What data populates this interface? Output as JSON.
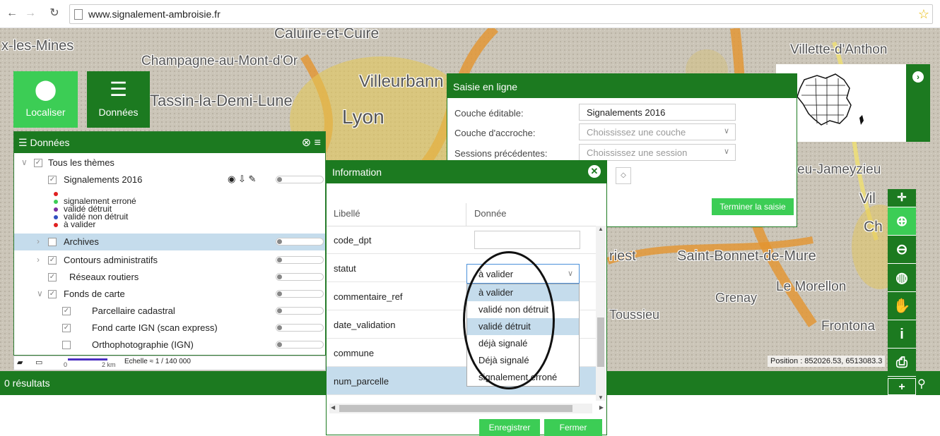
{
  "browser": {
    "url": "www.signalement-ambroisie.fr"
  },
  "map": {
    "places": [
      "x-les-Mines",
      "Champagne-au-Mont-d'Or",
      "Caluire-et-Cuire",
      "Villeurbann",
      "Lyon",
      "Tassin-la-Demi-Lune",
      "Villette-d'Anthon",
      "eu-Jameyzieu",
      "riest",
      "Saint-Bonnet-de-Mure",
      "Le Morellon",
      "Grenay",
      "Toussieu",
      "Frontona",
      "Vil",
      "Ch"
    ]
  },
  "tools": {
    "localiser": "Localiser",
    "donnees": "Données"
  },
  "layers_panel": {
    "title": "Données",
    "root": "Tous les thèmes",
    "signalements": "Signalements 2016",
    "legend": [
      {
        "label": "",
        "color": "#e02020"
      },
      {
        "label": "signalement erroné",
        "color": "#3ccd55"
      },
      {
        "label": "validé détruit",
        "color": "#7b2fa0"
      },
      {
        "label": "validé non détruit",
        "color": "#3050c0"
      },
      {
        "label": "à valider",
        "color": "#e02020"
      }
    ],
    "archives": "Archives",
    "contours": "Contours administratifs",
    "reseaux": "Réseaux routiers",
    "fonds": "Fonds de carte",
    "parcellaire": "Parcellaire cadastral",
    "ign": "Fond carte IGN (scan express)",
    "ortho": "Orthophotographie (IGN)"
  },
  "scale": {
    "zero": "0",
    "dist": "2 km",
    "label": "Echelle ≈ 1 / 140 000"
  },
  "position": "Position : 852026.53, 6513083.3",
  "results": "0 résultats",
  "saisie": {
    "title": "Saisie en ligne",
    "couche_label": "Couche éditable:",
    "couche_value": "Signalements 2016",
    "accroche_label": "Couche d'accroche:",
    "accroche_placeholder": "Choississez une couche",
    "sessions_label": "Sessions précédentes:",
    "sessions_placeholder": "Choississez une session",
    "terminer": "Terminer la saisie"
  },
  "info": {
    "title": "Information",
    "col_libelle": "Libellé",
    "col_donnee": "Donnée",
    "rows": [
      "code_dpt",
      "statut",
      "commentaire_ref",
      "date_validation",
      "commune",
      "num_parcelle"
    ],
    "statut_value": "à valider",
    "options": [
      "à valider",
      "validé non détruit",
      "validé détruit",
      "déjà signalé",
      "Déjà signalé",
      "signalement erroné"
    ],
    "enregistrer": "Enregistrer",
    "fermer": "Fermer"
  }
}
